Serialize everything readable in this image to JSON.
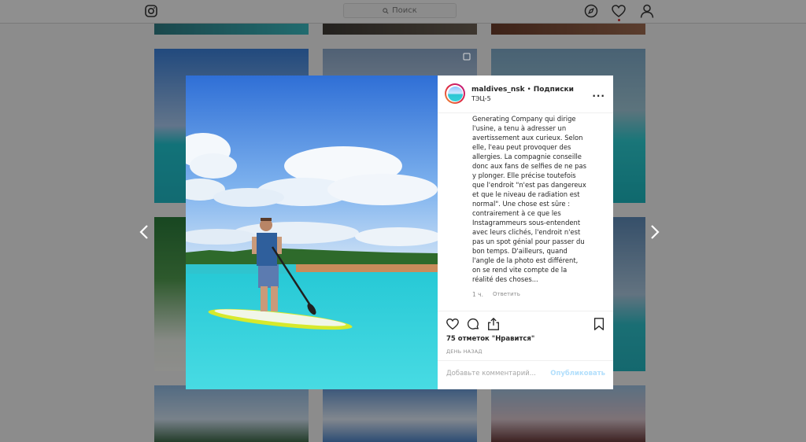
{
  "header": {
    "logo_icon": "instagram-icon",
    "search_placeholder": "Поиск",
    "nav_icons": [
      "compass-icon",
      "heart-icon",
      "profile-icon"
    ]
  },
  "modal": {
    "username": "maldives_nsk",
    "separator": "•",
    "follow_label": "Подписки",
    "location": "ТЭЦ-5",
    "more_label": "...",
    "caption_lines": [
      "Generating Company qui dirige",
      "l'usine, a tenu à adresser un",
      "avertissement aux curieux. Selon",
      "elle, l'eau peut provoquer des",
      "allergies. La compagnie conseille",
      "donc aux fans de selfies de ne pas",
      "y plonger. Elle précise toutefois",
      "que l'endroit \"n'est pas dangereux",
      "et que le niveau de radiation est",
      "normal\". Une chose est sûre :",
      "contrairement à ce que les",
      "Instagrammeurs sous-entendent",
      "avec leurs clichés, l'endroit n'est",
      "pas un spot génial pour passer du",
      "bon temps. D'ailleurs, quand",
      "l'angle de la photo est différent,",
      "on se rend vite compte de la",
      "réalité des choses..."
    ],
    "comment_age": "1 ч.",
    "reply_label": "Ответить",
    "likes_text": "75 отметок \"Нравится\"",
    "posted_text": "ДЕНЬ НАЗАД",
    "comment_placeholder": "Добавьте комментарий...",
    "publish_label": "Опубликовать"
  },
  "colors": {
    "accent": "#b2dffc",
    "overlay": "#8c8c8c",
    "text": "#262626",
    "muted": "#8e8e8e"
  }
}
